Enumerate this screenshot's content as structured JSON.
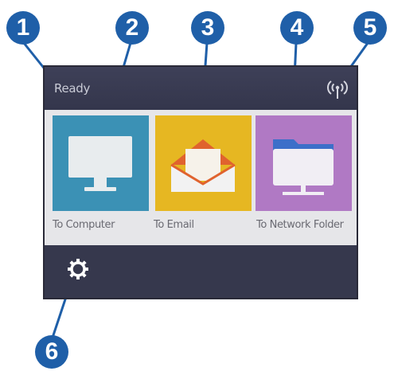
{
  "callouts": [
    "1",
    "2",
    "3",
    "4",
    "5",
    "6"
  ],
  "status_bar": {
    "status_text": "Ready",
    "wireless_icon": "wireless-icon"
  },
  "tiles": [
    {
      "label": "To Computer",
      "icon": "computer-monitor-icon",
      "color": "#3b91b5"
    },
    {
      "label": "To Email",
      "icon": "envelope-icon",
      "color": "#e6b722"
    },
    {
      "label": "To Network Folder",
      "icon": "network-folder-icon",
      "color": "#b079c4"
    }
  ],
  "bottom_bar": {
    "settings_icon": "gear-icon"
  },
  "colors": {
    "callout": "#1f5fa8",
    "screen_bg": "#333449",
    "content_bg": "#e6e6e9"
  }
}
